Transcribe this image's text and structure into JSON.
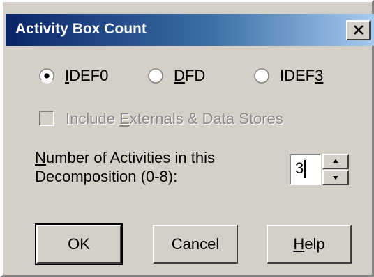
{
  "window": {
    "title": "Activity Box Count",
    "close_icon": "close-icon"
  },
  "method": {
    "options": [
      {
        "label_pre": "",
        "label_u": "I",
        "label_post": "DEF0",
        "selected": true
      },
      {
        "label_pre": "",
        "label_u": "D",
        "label_post": "FD",
        "selected": false
      },
      {
        "label_pre": "IDEF",
        "label_u": "3",
        "label_post": "",
        "selected": false
      }
    ]
  },
  "externals": {
    "label_pre": "Include ",
    "label_u": "E",
    "label_post": "xternals & Data Stores",
    "checked": false,
    "enabled": false
  },
  "activities": {
    "label_line1_u": "N",
    "label_line1_rest": "umber of Activities in this",
    "label_line2": "Decomposition (0-8):",
    "value": "3"
  },
  "buttons": {
    "ok_label": "OK",
    "cancel_label": "Cancel",
    "help_u": "H",
    "help_rest": "elp"
  },
  "colors": {
    "dialog_face": "#d4d0c8",
    "title_start": "#0a246a",
    "title_end": "#a6caf0",
    "disabled_text": "#8a8a8a"
  }
}
